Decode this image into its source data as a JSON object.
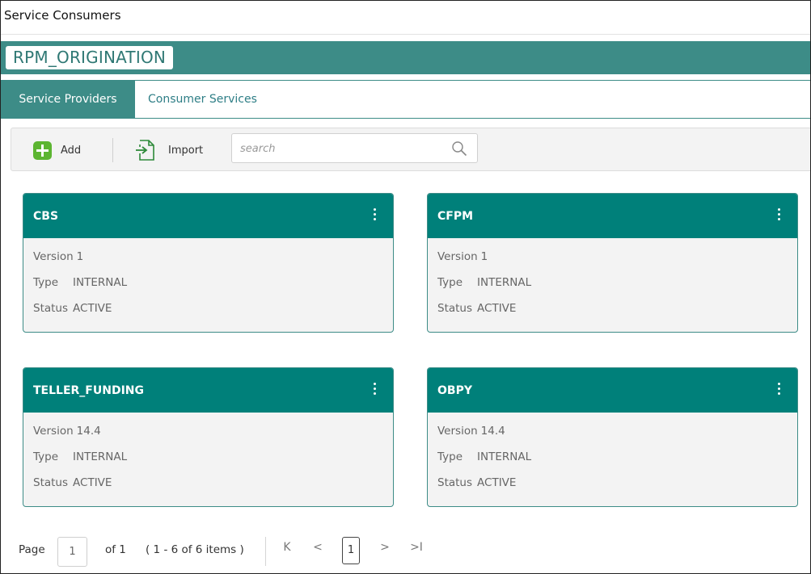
{
  "window": {
    "title": "Service Consumers"
  },
  "app": {
    "name": "RPM_ORIGINATION"
  },
  "tabs": [
    {
      "label": "Service Providers",
      "active": true
    },
    {
      "label": "Consumer Services",
      "active": false
    }
  ],
  "toolbar": {
    "add_label": "Add",
    "import_label": "Import",
    "search_placeholder": "search"
  },
  "field_labels": {
    "version": "Version",
    "type": "Type",
    "status": "Status"
  },
  "cards": [
    {
      "name": "CBS",
      "version": "1",
      "type": "INTERNAL",
      "status": "ACTIVE"
    },
    {
      "name": "CFPM",
      "version": "1",
      "type": "INTERNAL",
      "status": "ACTIVE"
    },
    {
      "name": "TELLER_FUNDING",
      "version": "14.4",
      "type": "INTERNAL",
      "status": "ACTIVE"
    },
    {
      "name": "OBPY",
      "version": "14.4",
      "type": "INTERNAL",
      "status": "ACTIVE"
    }
  ],
  "pagination": {
    "page_label": "Page",
    "page_value": "1",
    "of_label": "of 1",
    "items_summary": "( 1 - 6 of 6 items )",
    "current_page": "1",
    "first_glyph": "K",
    "prev_glyph": "<",
    "next_glyph": ">",
    "last_glyph": ">I"
  },
  "colors": {
    "teal": "#3d8c87",
    "card_header": "#00807a",
    "add_green": "#5cb531",
    "link": "#2e7e86"
  },
  "icons": [
    "add-icon",
    "import-icon",
    "search-icon",
    "kebab-menu-icon"
  ]
}
